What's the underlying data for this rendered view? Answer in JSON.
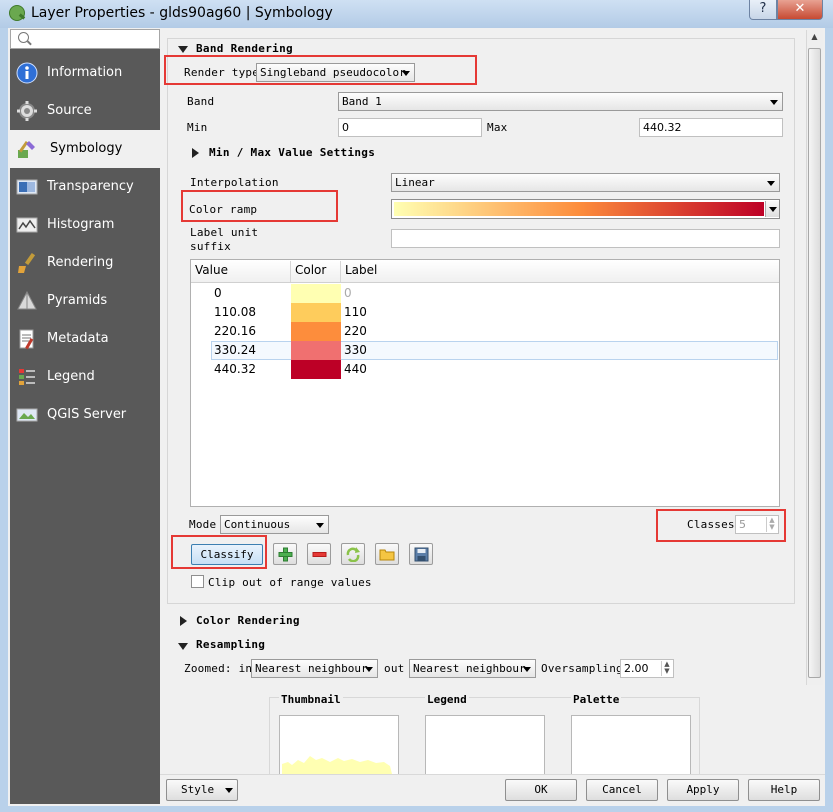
{
  "window": {
    "title": "Layer Properties - glds90ag60 | Symbology",
    "help": "?",
    "close": "✕"
  },
  "sidebar": {
    "search_placeholder": "",
    "items": [
      {
        "label": "Information",
        "icon": "information-icon"
      },
      {
        "label": "Source",
        "icon": "source-icon"
      },
      {
        "label": "Symbology",
        "icon": "symbology-icon"
      },
      {
        "label": "Transparency",
        "icon": "transparency-icon"
      },
      {
        "label": "Histogram",
        "icon": "histogram-icon"
      },
      {
        "label": "Rendering",
        "icon": "rendering-icon"
      },
      {
        "label": "Pyramids",
        "icon": "pyramids-icon"
      },
      {
        "label": "Metadata",
        "icon": "metadata-icon"
      },
      {
        "label": "Legend",
        "icon": "legend-icon"
      },
      {
        "label": "QGIS Server",
        "icon": "qgis-server-icon"
      }
    ]
  },
  "band_rendering": {
    "title": "Band Rendering",
    "render_type_label": "Render type",
    "render_type_value": "Singleband pseudocolor",
    "band_label": "Band",
    "band_value": "Band 1",
    "min_label": "Min",
    "min_value": "0",
    "max_label": "Max",
    "max_value": "440.32",
    "minmax_settings": "Min / Max Value Settings",
    "interpolation_label": "Interpolation",
    "interpolation_value": "Linear",
    "color_ramp_label": "Color ramp",
    "label_unit_line1": "Label unit",
    "label_unit_line2": "suffix",
    "label_unit_value": "",
    "table": {
      "headers": [
        "Value",
        "Color",
        "Label"
      ],
      "rows": [
        {
          "value": "0",
          "color": "#ffffb2",
          "label": "0"
        },
        {
          "value": "110.08",
          "color": "#fecc5c",
          "label": "110"
        },
        {
          "value": "220.16",
          "color": "#fd8d3c",
          "label": "220"
        },
        {
          "value": "330.24",
          "color": "#f07070",
          "label": "330"
        },
        {
          "value": "440.32",
          "color": "#bd0026",
          "label": "440"
        }
      ]
    },
    "mode_label": "Mode",
    "mode_value": "Continuous",
    "classes_label": "Classes",
    "classes_value": "5",
    "classify_button": "Classify",
    "clip_label": "Clip out of range values"
  },
  "color_rendering": {
    "title": "Color Rendering"
  },
  "resampling": {
    "title": "Resampling",
    "zoomed_in_label": "Zoomed: in",
    "zoomed_in_value": "Nearest neighbour",
    "out_label": "out",
    "zoomed_out_value": "Nearest neighbour",
    "oversampling_label": "Oversampling",
    "oversampling_value": "2.00"
  },
  "previews": {
    "thumbnail": "Thumbnail",
    "legend": "Legend",
    "palette": "Palette"
  },
  "footer": {
    "style": "Style",
    "ok": "OK",
    "cancel": "Cancel",
    "apply": "Apply",
    "help": "Help"
  },
  "colors": {
    "ramp_start": "#ffffb2",
    "ramp_mid": "#fd8d3c",
    "ramp_end": "#bd0026",
    "highlight": "#e53935",
    "sidebar_bg": "#595959"
  }
}
